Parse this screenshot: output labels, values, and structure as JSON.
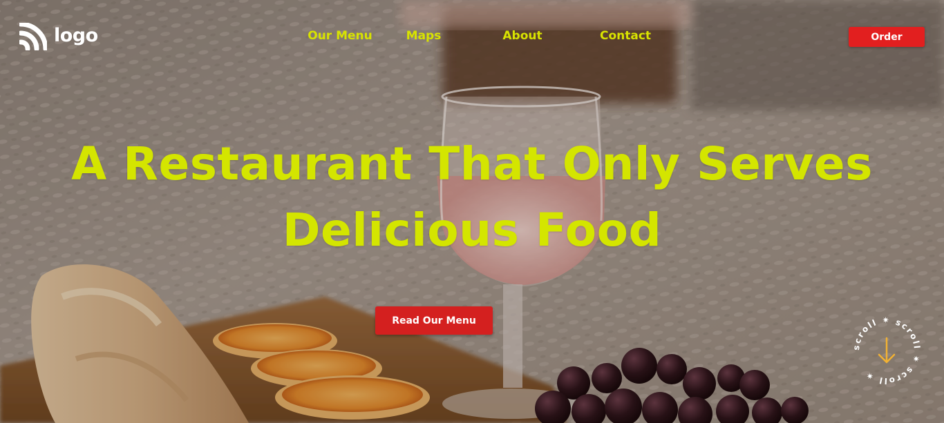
{
  "header": {
    "logo_text": "logo",
    "logo_icon": "wifi-rss-icon",
    "nav": [
      {
        "label": "Our Menu"
      },
      {
        "label": "Maps"
      },
      {
        "label": "About"
      },
      {
        "label": "Contact"
      }
    ],
    "order_label": "Order"
  },
  "hero": {
    "title_line1": "A Restaurant That Only Serves",
    "title_line2": "Delicious Food",
    "cta_label": "Read Our Menu",
    "scroll_text": "scroll ✷ scroll ✷ scroll ✷",
    "scroll_icon": "arrow-down-icon"
  },
  "colors": {
    "accent": "#d4e500",
    "button": "#e21f1f",
    "arrow": "#f2b233"
  }
}
